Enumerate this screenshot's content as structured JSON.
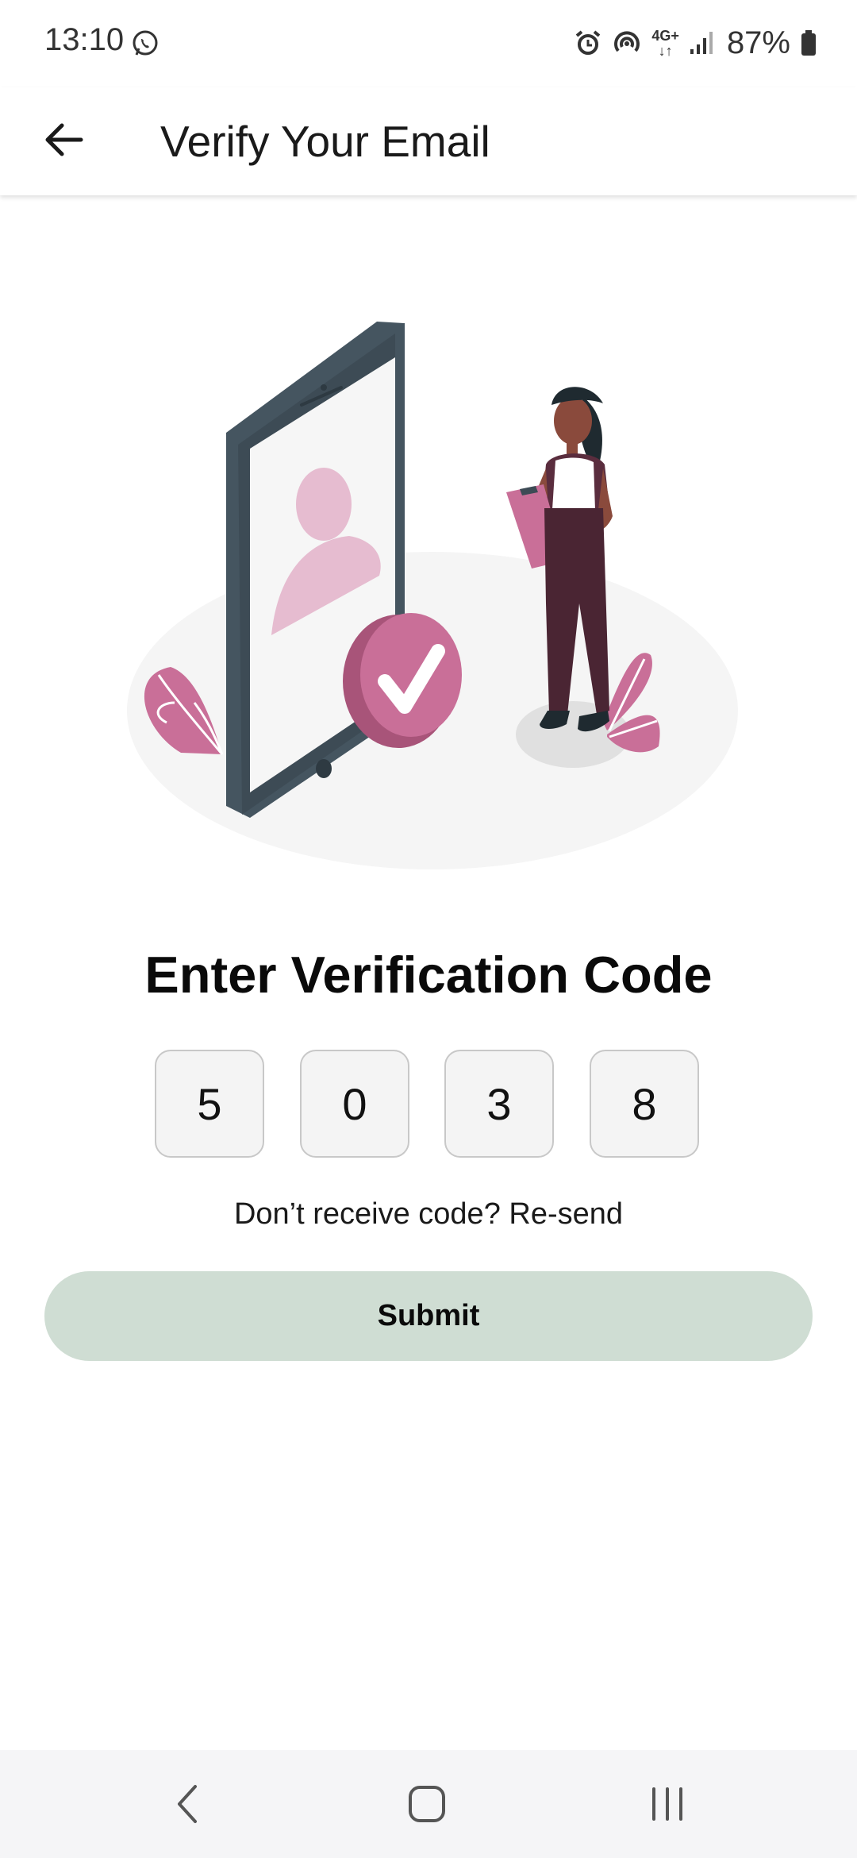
{
  "status_bar": {
    "time": "13:10",
    "network": "4G+",
    "battery": "87%",
    "icons": [
      "whatsapp-icon",
      "alarm-icon",
      "hotspot-icon",
      "network-4g-icon",
      "signal-icon",
      "battery-icon"
    ]
  },
  "app_bar": {
    "title": "Verify Your Email",
    "back_icon": "arrow-left-icon"
  },
  "illustration": {
    "name": "verification-illustration"
  },
  "verification": {
    "heading": "Enter Verification Code",
    "code": [
      "5",
      "0",
      "3",
      "8"
    ],
    "resend_prompt": "Don’t receive code?",
    "resend_link": "Re-send",
    "submit_label": "Submit"
  },
  "nav_bar": {
    "icons": [
      "back-nav-icon",
      "home-nav-icon",
      "recents-nav-icon"
    ]
  },
  "colors": {
    "accent_pink": "#c96f98",
    "light_pink": "#e6bcd0",
    "phone_dark": "#455560",
    "submit_bg": "#cfddd3",
    "code_box_bg": "#f4f4f4",
    "nav_bar_bg": "#f5f5f7"
  }
}
